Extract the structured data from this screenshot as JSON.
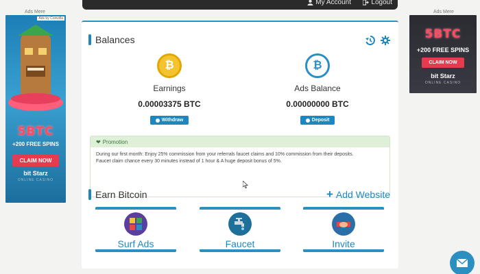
{
  "topnav": {
    "account_label": "My Account",
    "logout_label": "Logout"
  },
  "ads": {
    "label_left": "Ads Mere",
    "label_right": "Ads Mere",
    "left": {
      "tag": "Ads by Coinzilla",
      "bonus": "5BTC",
      "spins": "+200 FREE SPINS",
      "cta": "CLAIM NOW",
      "brand": "bit Starz",
      "brand_sub": "ONLINE CASINO"
    },
    "right": {
      "bonus": "5BTC",
      "spins": "+200 FREE SPINS",
      "cta": "CLAIM NOW",
      "brand": "bit Starz",
      "brand_sub": "ONLINE CASINO"
    }
  },
  "balances": {
    "title": "Balances",
    "earnings": {
      "label": "Earnings",
      "value": "0.00003375 BTC",
      "button": "Withdraw"
    },
    "ads_balance": {
      "label": "Ads Balance",
      "value": "0.00000000 BTC",
      "button": "Deposit"
    }
  },
  "promotion": {
    "title": "Promotion",
    "line1": "During our first month: Enjoy 25% commission from your referrals faucet claims and 10% commission from their deposits.",
    "line2": "Faucet claim chance every 30 minutes instead of 1 hour & A huge deposit bonus of 5%."
  },
  "earn": {
    "title": "Earn Bitcoin",
    "add_website": "Add Website",
    "cards": [
      {
        "label": "Surf Ads"
      },
      {
        "label": "Faucet"
      },
      {
        "label": "Invite"
      }
    ]
  },
  "colors": {
    "accent": "#1e87c2",
    "promo_bg": "#dff0d8",
    "nav_bg": "#2a2a2a"
  }
}
